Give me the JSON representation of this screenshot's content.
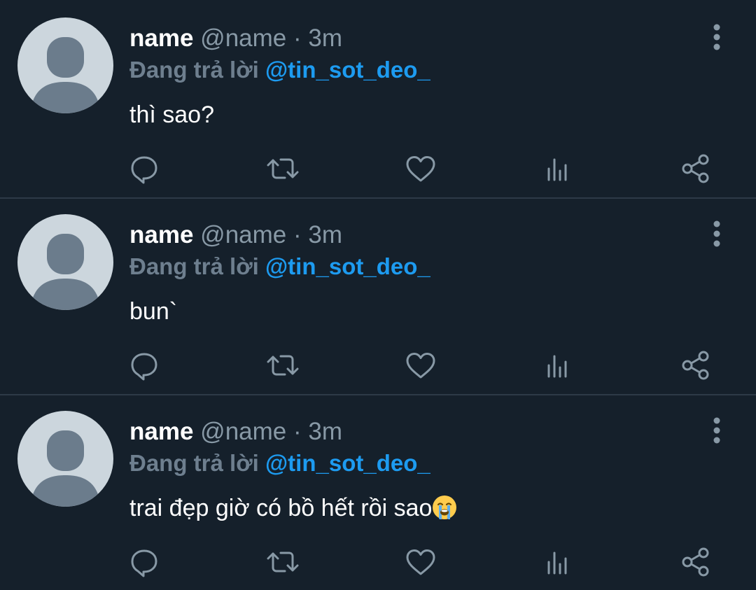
{
  "colors": {
    "background": "#15202b",
    "divider": "#2d3a47",
    "name": "#ffffff",
    "muted": "#8899a6",
    "mention": "#1d9bf0",
    "icon": "#8899a6",
    "avatar_bg": "#ccd6dd",
    "avatar_figure": "#6b7c8c"
  },
  "icons": {
    "reply": "reply-icon",
    "retweet": "retweet-icon",
    "like": "like-icon",
    "analytics": "analytics-icon",
    "share": "share-icon",
    "more": "more-vertical-icon",
    "avatar": "default-avatar-icon",
    "emoji": "loudly-crying-face-emoji"
  },
  "tweets": [
    {
      "display_name": "name",
      "handle": "@name",
      "separator": "·",
      "time": "3m",
      "reply_prefix": "Đang trả lời",
      "reply_to": "@tin_sot_deo_",
      "text": "thì sao?"
    },
    {
      "display_name": "name",
      "handle": "@name",
      "separator": "·",
      "time": "3m",
      "reply_prefix": "Đang trả lời",
      "reply_to": "@tin_sot_deo_",
      "text": "bun`"
    },
    {
      "display_name": "name",
      "handle": "@name",
      "separator": "·",
      "time": "3m",
      "reply_prefix": "Đang trả lời",
      "reply_to": "@tin_sot_deo_",
      "text": "trai đẹp giờ có bồ hết rồi sao"
    }
  ]
}
